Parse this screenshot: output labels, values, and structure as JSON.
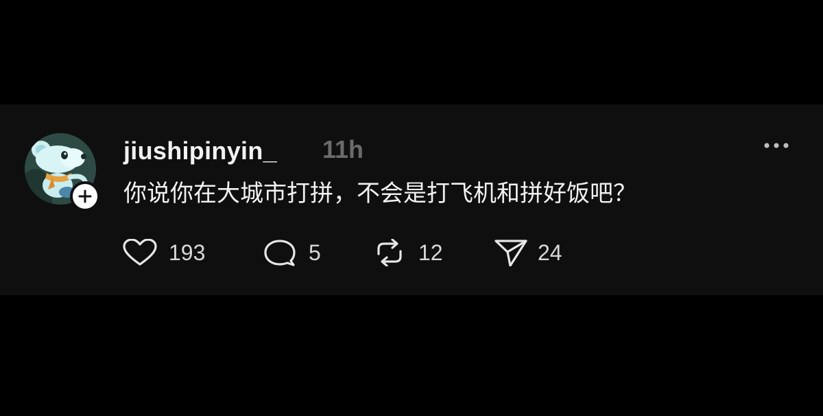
{
  "post": {
    "username": "jiushipinyin_",
    "timestamp": "11h",
    "text": "你说你在大城市打拼，不会是打飞机和拼好饭吧？",
    "avatar_icon": "cartoon-mouse-avatar",
    "follow_icon": "plus-icon",
    "more_icon": "more-dots-icon"
  },
  "actions": {
    "like": {
      "icon": "heart-icon",
      "count": "193"
    },
    "reply": {
      "icon": "speech-bubble-icon",
      "count": "5"
    },
    "repost": {
      "icon": "repost-arrows-icon",
      "count": "12"
    },
    "share": {
      "icon": "paper-plane-icon",
      "count": "24"
    }
  },
  "colors": {
    "background": "#000000",
    "post_background": "#0f0f10",
    "text_primary": "#f2f2f2",
    "text_muted": "#6b6b6b"
  }
}
